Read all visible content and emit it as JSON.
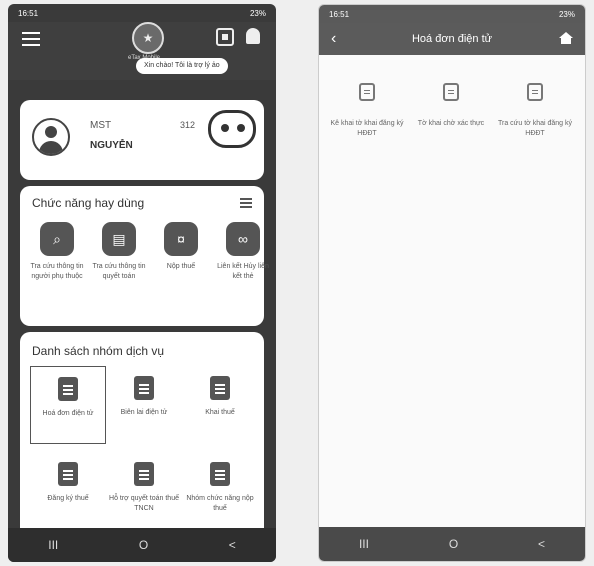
{
  "left_phone": {
    "status": {
      "time": "16:51",
      "right": "23%"
    },
    "logo_caption": "eTax Mobile",
    "greeting": "Xin chào! Tôi là trợ lý ảo",
    "profile": {
      "mst_label": "MST",
      "mst_value": "312",
      "name": "NGUYỄN"
    },
    "frequent": {
      "title": "Chức năng hay dùng",
      "items": [
        {
          "label": "Tra cứu thông tin người phụ thuộc"
        },
        {
          "label": "Tra cứu thông tin quyết toán"
        },
        {
          "label": "Nộp thuế"
        },
        {
          "label": "Liên kết Hủy liên kết thẻ"
        }
      ]
    },
    "services": {
      "title": "Danh sách nhóm dịch vụ",
      "items": [
        {
          "label": "Hoá đơn điện tử"
        },
        {
          "label": "Biên lai điện tử"
        },
        {
          "label": "Khai thuế"
        },
        {
          "label": "Đăng ký thuế"
        },
        {
          "label": "Hỗ trợ quyết toán thuế TNCN"
        },
        {
          "label": "Nhóm chức năng nộp thuế"
        }
      ]
    },
    "navbar": {
      "recent": "III",
      "home": "O",
      "back": "<"
    }
  },
  "right_phone": {
    "status": {
      "time": "16:51",
      "right": "23%"
    },
    "title": "Hoá đơn điện tử",
    "items": [
      {
        "label": "Kê khai tờ khai đăng ký HĐĐT"
      },
      {
        "label": "Tờ khai chờ xác thực"
      },
      {
        "label": "Tra cứu tờ khai đăng ký HĐĐT"
      }
    ],
    "navbar": {
      "recent": "III",
      "home": "O",
      "back": "<"
    }
  }
}
